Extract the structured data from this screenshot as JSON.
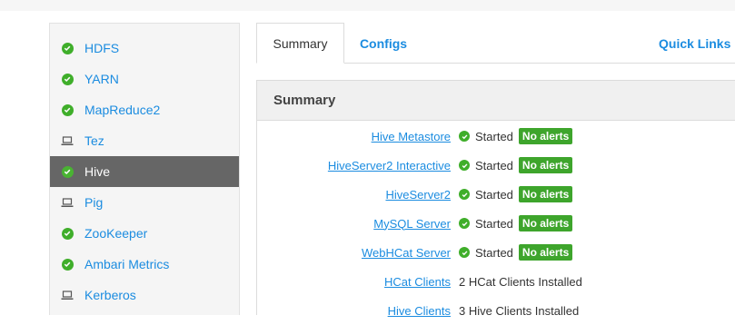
{
  "sidebar": {
    "items": [
      {
        "label": "HDFS",
        "icon": "check-circle-icon",
        "active": false
      },
      {
        "label": "YARN",
        "icon": "check-circle-icon",
        "active": false
      },
      {
        "label": "MapReduce2",
        "icon": "check-circle-icon",
        "active": false
      },
      {
        "label": "Tez",
        "icon": "laptop-icon",
        "active": false
      },
      {
        "label": "Hive",
        "icon": "check-circle-icon",
        "active": true
      },
      {
        "label": "Pig",
        "icon": "laptop-icon",
        "active": false
      },
      {
        "label": "ZooKeeper",
        "icon": "check-circle-icon",
        "active": false
      },
      {
        "label": "Ambari Metrics",
        "icon": "check-circle-icon",
        "active": false
      },
      {
        "label": "Kerberos",
        "icon": "laptop-icon",
        "active": false
      }
    ]
  },
  "tabs": {
    "summary": "Summary",
    "configs": "Configs",
    "quick_links": "Quick Links"
  },
  "panel": {
    "title": "Summary",
    "rows": [
      {
        "name": "Hive Metastore",
        "status": "Started",
        "badge": "No alerts"
      },
      {
        "name": "HiveServer2 Interactive",
        "status": "Started",
        "badge": "No alerts"
      },
      {
        "name": "HiveServer2",
        "status": "Started",
        "badge": "No alerts"
      },
      {
        "name": "MySQL Server",
        "status": "Started",
        "badge": "No alerts"
      },
      {
        "name": "WebHCat Server",
        "status": "Started",
        "badge": "No alerts"
      },
      {
        "name": "HCat Clients",
        "status": "2 HCat Clients Installed",
        "badge": null
      },
      {
        "name": "Hive Clients",
        "status": "3 Hive Clients Installed",
        "badge": null
      }
    ]
  },
  "colors": {
    "link": "#1b8ce0",
    "ok_green": "#3fae2a",
    "active_bg": "#666666"
  }
}
